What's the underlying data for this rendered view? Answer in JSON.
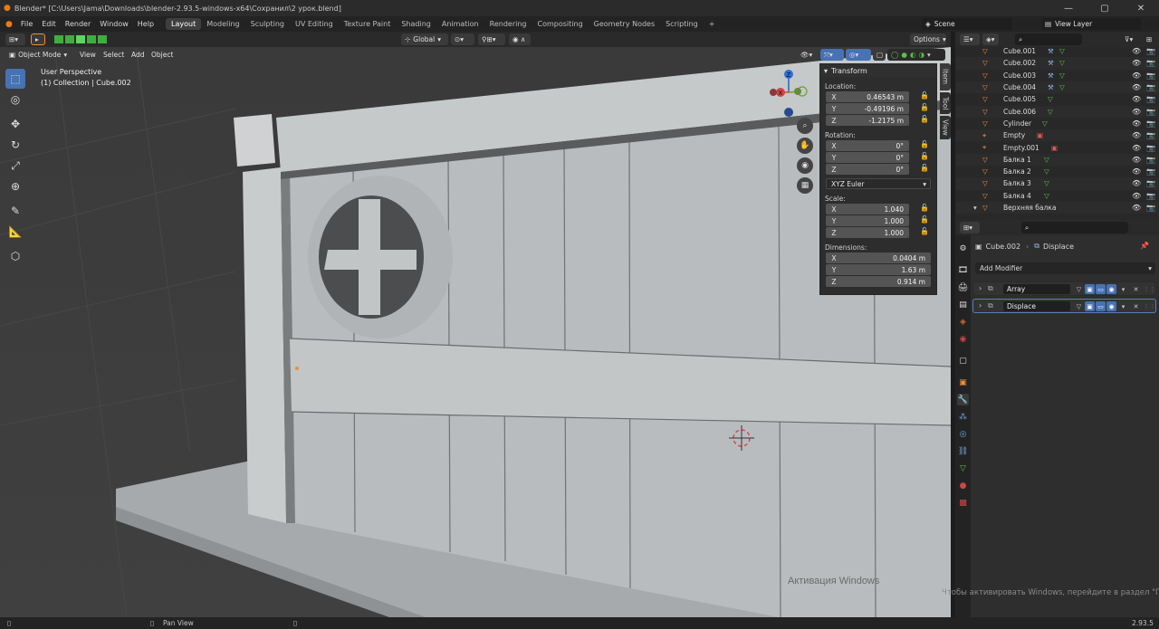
{
  "window": {
    "title": "Blender* [C:\\Users\\Jama\\Downloads\\blender-2.93.5-windows-x64\\Сохранил\\2 урок.blend]"
  },
  "menu": {
    "items": [
      "File",
      "Edit",
      "Render",
      "Window",
      "Help"
    ]
  },
  "workspaces": {
    "tabs": [
      "Layout",
      "Modeling",
      "Sculpting",
      "UV Editing",
      "Texture Paint",
      "Shading",
      "Animation",
      "Rendering",
      "Compositing",
      "Geometry Nodes",
      "Scripting"
    ],
    "active": "Layout",
    "add": "+"
  },
  "topright": {
    "scene": "Scene",
    "view_layer": "View Layer"
  },
  "header": {
    "orientation": "Global",
    "options": "Options"
  },
  "viewport": {
    "mode": "Object Mode",
    "menus": [
      "View",
      "Select",
      "Add",
      "Object"
    ],
    "info_line1": "User Perspective",
    "info_line2": "(1) Collection | Cube.002"
  },
  "npanel": {
    "title": "Transform",
    "location_label": "Location:",
    "location": [
      "0.46543 m",
      "-0.49196 m",
      "-1.2175 m"
    ],
    "rotation_label": "Rotation:",
    "rotation": [
      "0°",
      "0°",
      "0°"
    ],
    "rotation_mode": "XYZ Euler",
    "scale_label": "Scale:",
    "scale": [
      "1.040",
      "1.000",
      "1.000"
    ],
    "dimensions_label": "Dimensions:",
    "dimensions": [
      "0.0404 m",
      "1.63 m",
      "0.914 m"
    ],
    "axes": [
      "X",
      "Y",
      "Z"
    ],
    "tabs": [
      "Item",
      "Tool",
      "View"
    ]
  },
  "outliner": {
    "items": [
      "Cube.001",
      "Cube.002",
      "Cube.003",
      "Cube.004",
      "Cube.005",
      "Cube.006",
      "Cylinder",
      "Empty",
      "Empty.001",
      "Балка 1",
      "Балка 2",
      "Балка 3",
      "Балка 4",
      "Верхняя балка"
    ]
  },
  "properties": {
    "object": "Cube.002",
    "modifier": "Displace",
    "add_modifier": "Add Modifier",
    "modifiers": [
      "Array",
      "Displace"
    ]
  },
  "status": {
    "action": "Pan View",
    "version": "2.93.5",
    "watermark1": "Активация Windows",
    "watermark2": "Чтобы активировать Windows, перейдите в раздел \"Параметры\"."
  },
  "colors": {
    "accent": "#4772b3",
    "mesh_green": "#59c14a",
    "object_orange": "#e8913a"
  }
}
